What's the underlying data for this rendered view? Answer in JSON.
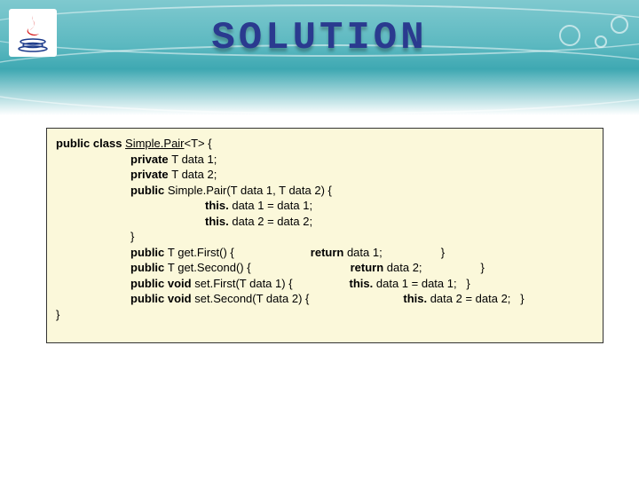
{
  "title": "SOLUTION",
  "code": {
    "l1_a": "public class ",
    "l1_cls": "Simple.Pair",
    "l1_b": "<T> {",
    "l2_a": "private ",
    "l2_b": "T data 1;",
    "l3_a": "private ",
    "l3_b": "T data 2;",
    "l4_a": "public ",
    "l4_b": "Simple.Pair(T data 1, T data 2) {",
    "l5_a": "this. ",
    "l5_b": "data 1 = data 1;",
    "l6_a": "this. ",
    "l6_b": "data 2 = data 2;",
    "l7": "}",
    "l8_a": "public ",
    "l8_b": "T get.First() {",
    "l8_c": "return ",
    "l8_d": "data 1;",
    "l8_e": "}",
    "l9_a": "public ",
    "l9_b": "T get.Second() {",
    "l9_c": "return ",
    "l9_d": "data 2;",
    "l9_e": "}",
    "l10_a": "public void ",
    "l10_b": "set.First(T data 1) {",
    "l10_c": "this. ",
    "l10_d": "data 1 = data 1;   }",
    "l11_a": "public void ",
    "l11_b": "set.Second(T data 2) {",
    "l11_c": "this. ",
    "l11_d": "data 2 = data 2;   }",
    "l12": "}"
  }
}
